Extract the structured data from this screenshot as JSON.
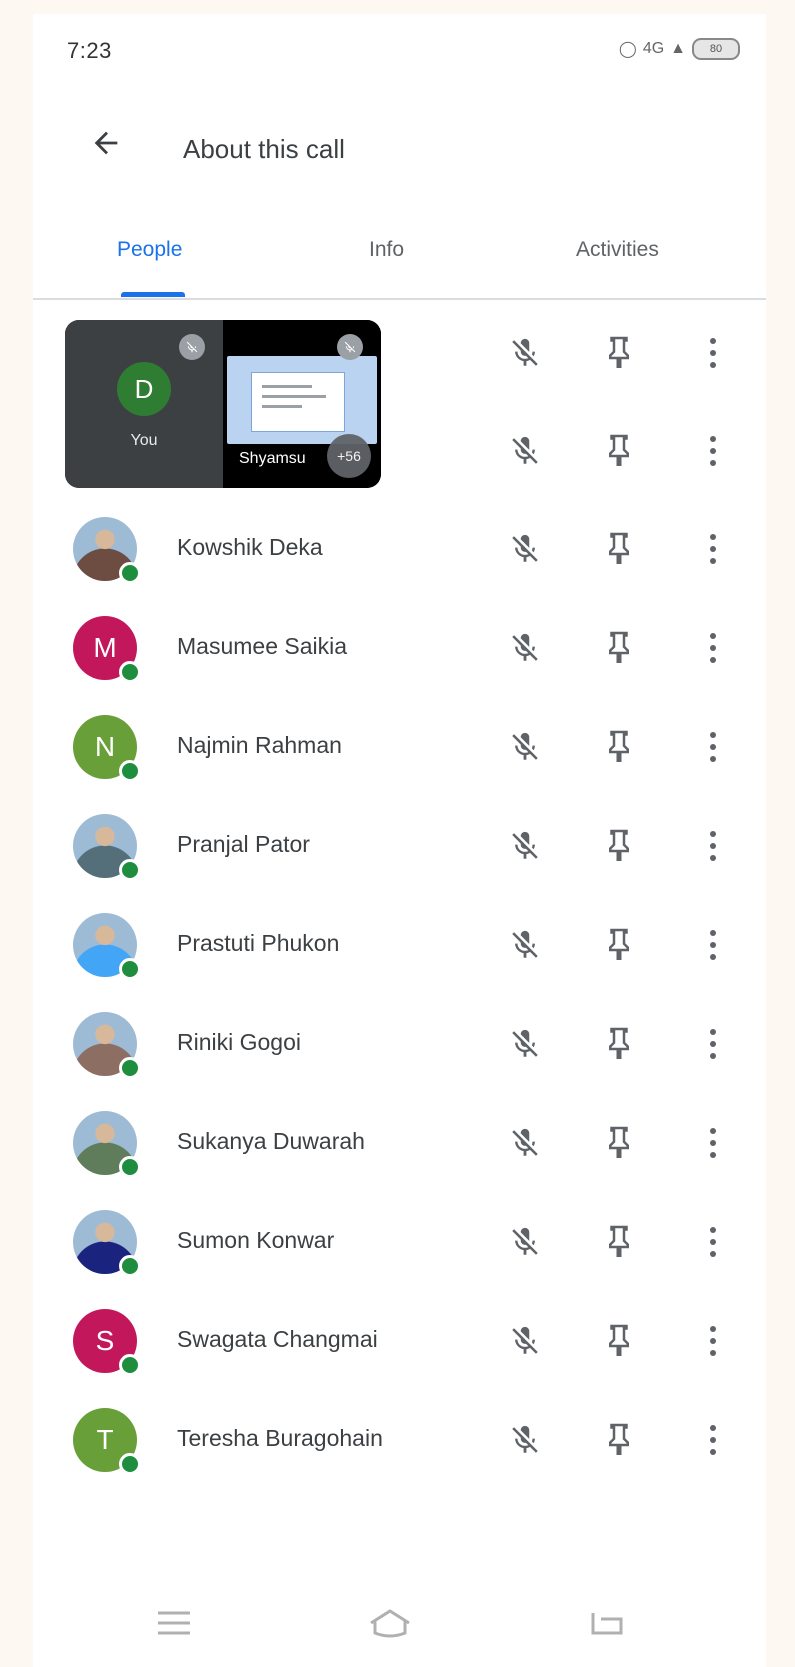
{
  "status_bar": {
    "time": "7:23",
    "network_label": "4G",
    "battery": "80"
  },
  "app_bar": {
    "title": "About this call",
    "back_icon": "arrow-back-icon"
  },
  "tabs": [
    {
      "label": "People",
      "active": true
    },
    {
      "label": "Info",
      "active": false
    },
    {
      "label": "Activities",
      "active": false
    }
  ],
  "video_tiles": {
    "self_initial": "D",
    "self_label": "You",
    "presenter_label": "Shyamsu",
    "more_count": "+56"
  },
  "participants": [
    {
      "name": "Kowshik Deka",
      "initial": "",
      "avatar_color": "#6d4c41",
      "photo": true
    },
    {
      "name": "Masumee Saikia",
      "initial": "M",
      "avatar_color": "#c2185b",
      "photo": false
    },
    {
      "name": "Najmin Rahman",
      "initial": "N",
      "avatar_color": "#689f38",
      "photo": false
    },
    {
      "name": "Pranjal Pator",
      "initial": "",
      "avatar_color": "#546e7a",
      "photo": true
    },
    {
      "name": "Prastuti Phukon",
      "initial": "",
      "avatar_color": "#42a5f5",
      "photo": true
    },
    {
      "name": "Riniki Gogoi",
      "initial": "",
      "avatar_color": "#8d6e63",
      "photo": true
    },
    {
      "name": "Sukanya Duwarah",
      "initial": "",
      "avatar_color": "#607d5b",
      "photo": true
    },
    {
      "name": "Sumon Konwar",
      "initial": "",
      "avatar_color": "#1a237e",
      "photo": true
    },
    {
      "name": "Swagata Changmai",
      "initial": "S",
      "avatar_color": "#c2185b",
      "photo": false
    },
    {
      "name": "Teresha Buragohain",
      "initial": "T",
      "avatar_color": "#689f38",
      "photo": false
    }
  ],
  "row_icons": {
    "mic": "mic-off-icon",
    "pin": "pin-icon",
    "more": "more-vert-icon"
  },
  "colors": {
    "accent": "#1a73e8",
    "online": "#1e8e3e"
  },
  "nav_bar": [
    "menu-icon",
    "home-icon",
    "back-icon"
  ]
}
